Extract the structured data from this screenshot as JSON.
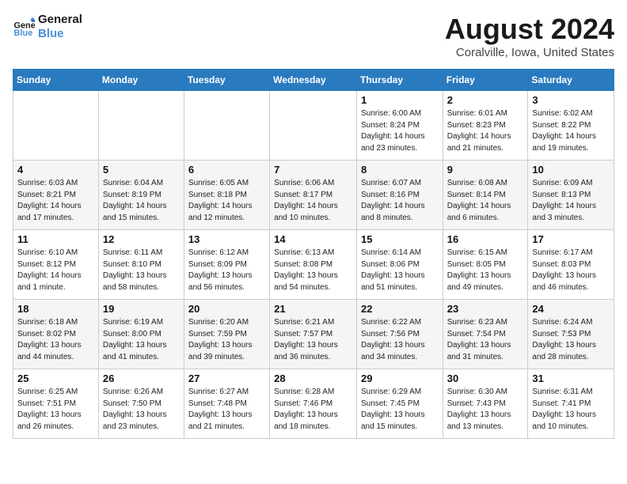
{
  "header": {
    "logo_line1": "General",
    "logo_line2": "Blue",
    "month_year": "August 2024",
    "location": "Coralville, Iowa, United States"
  },
  "days_of_week": [
    "Sunday",
    "Monday",
    "Tuesday",
    "Wednesday",
    "Thursday",
    "Friday",
    "Saturday"
  ],
  "weeks": [
    [
      {
        "day": "",
        "info": ""
      },
      {
        "day": "",
        "info": ""
      },
      {
        "day": "",
        "info": ""
      },
      {
        "day": "",
        "info": ""
      },
      {
        "day": "1",
        "info": "Sunrise: 6:00 AM\nSunset: 8:24 PM\nDaylight: 14 hours\nand 23 minutes."
      },
      {
        "day": "2",
        "info": "Sunrise: 6:01 AM\nSunset: 8:23 PM\nDaylight: 14 hours\nand 21 minutes."
      },
      {
        "day": "3",
        "info": "Sunrise: 6:02 AM\nSunset: 8:22 PM\nDaylight: 14 hours\nand 19 minutes."
      }
    ],
    [
      {
        "day": "4",
        "info": "Sunrise: 6:03 AM\nSunset: 8:21 PM\nDaylight: 14 hours\nand 17 minutes."
      },
      {
        "day": "5",
        "info": "Sunrise: 6:04 AM\nSunset: 8:19 PM\nDaylight: 14 hours\nand 15 minutes."
      },
      {
        "day": "6",
        "info": "Sunrise: 6:05 AM\nSunset: 8:18 PM\nDaylight: 14 hours\nand 12 minutes."
      },
      {
        "day": "7",
        "info": "Sunrise: 6:06 AM\nSunset: 8:17 PM\nDaylight: 14 hours\nand 10 minutes."
      },
      {
        "day": "8",
        "info": "Sunrise: 6:07 AM\nSunset: 8:16 PM\nDaylight: 14 hours\nand 8 minutes."
      },
      {
        "day": "9",
        "info": "Sunrise: 6:08 AM\nSunset: 8:14 PM\nDaylight: 14 hours\nand 6 minutes."
      },
      {
        "day": "10",
        "info": "Sunrise: 6:09 AM\nSunset: 8:13 PM\nDaylight: 14 hours\nand 3 minutes."
      }
    ],
    [
      {
        "day": "11",
        "info": "Sunrise: 6:10 AM\nSunset: 8:12 PM\nDaylight: 14 hours\nand 1 minute."
      },
      {
        "day": "12",
        "info": "Sunrise: 6:11 AM\nSunset: 8:10 PM\nDaylight: 13 hours\nand 58 minutes."
      },
      {
        "day": "13",
        "info": "Sunrise: 6:12 AM\nSunset: 8:09 PM\nDaylight: 13 hours\nand 56 minutes."
      },
      {
        "day": "14",
        "info": "Sunrise: 6:13 AM\nSunset: 8:08 PM\nDaylight: 13 hours\nand 54 minutes."
      },
      {
        "day": "15",
        "info": "Sunrise: 6:14 AM\nSunset: 8:06 PM\nDaylight: 13 hours\nand 51 minutes."
      },
      {
        "day": "16",
        "info": "Sunrise: 6:15 AM\nSunset: 8:05 PM\nDaylight: 13 hours\nand 49 minutes."
      },
      {
        "day": "17",
        "info": "Sunrise: 6:17 AM\nSunset: 8:03 PM\nDaylight: 13 hours\nand 46 minutes."
      }
    ],
    [
      {
        "day": "18",
        "info": "Sunrise: 6:18 AM\nSunset: 8:02 PM\nDaylight: 13 hours\nand 44 minutes."
      },
      {
        "day": "19",
        "info": "Sunrise: 6:19 AM\nSunset: 8:00 PM\nDaylight: 13 hours\nand 41 minutes."
      },
      {
        "day": "20",
        "info": "Sunrise: 6:20 AM\nSunset: 7:59 PM\nDaylight: 13 hours\nand 39 minutes."
      },
      {
        "day": "21",
        "info": "Sunrise: 6:21 AM\nSunset: 7:57 PM\nDaylight: 13 hours\nand 36 minutes."
      },
      {
        "day": "22",
        "info": "Sunrise: 6:22 AM\nSunset: 7:56 PM\nDaylight: 13 hours\nand 34 minutes."
      },
      {
        "day": "23",
        "info": "Sunrise: 6:23 AM\nSunset: 7:54 PM\nDaylight: 13 hours\nand 31 minutes."
      },
      {
        "day": "24",
        "info": "Sunrise: 6:24 AM\nSunset: 7:53 PM\nDaylight: 13 hours\nand 28 minutes."
      }
    ],
    [
      {
        "day": "25",
        "info": "Sunrise: 6:25 AM\nSunset: 7:51 PM\nDaylight: 13 hours\nand 26 minutes."
      },
      {
        "day": "26",
        "info": "Sunrise: 6:26 AM\nSunset: 7:50 PM\nDaylight: 13 hours\nand 23 minutes."
      },
      {
        "day": "27",
        "info": "Sunrise: 6:27 AM\nSunset: 7:48 PM\nDaylight: 13 hours\nand 21 minutes."
      },
      {
        "day": "28",
        "info": "Sunrise: 6:28 AM\nSunset: 7:46 PM\nDaylight: 13 hours\nand 18 minutes."
      },
      {
        "day": "29",
        "info": "Sunrise: 6:29 AM\nSunset: 7:45 PM\nDaylight: 13 hours\nand 15 minutes."
      },
      {
        "day": "30",
        "info": "Sunrise: 6:30 AM\nSunset: 7:43 PM\nDaylight: 13 hours\nand 13 minutes."
      },
      {
        "day": "31",
        "info": "Sunrise: 6:31 AM\nSunset: 7:41 PM\nDaylight: 13 hours\nand 10 minutes."
      }
    ]
  ]
}
